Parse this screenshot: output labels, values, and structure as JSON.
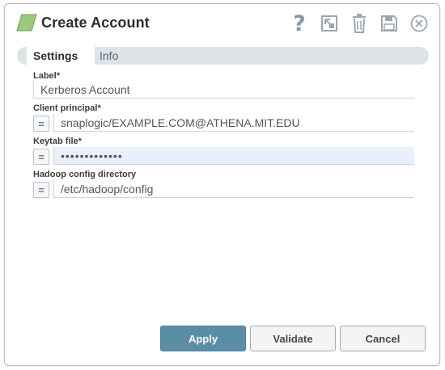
{
  "header": {
    "title": "Create Account",
    "help_label": "?",
    "icons": [
      "snap-logo-icon",
      "help-icon",
      "export-icon",
      "delete-icon",
      "save-icon",
      "close-icon"
    ]
  },
  "tabs": [
    {
      "label": "Settings",
      "active": true
    },
    {
      "label": "Info",
      "active": false
    }
  ],
  "fields": {
    "label": {
      "title": "Label*",
      "value": "Kerberos Account"
    },
    "client_principal": {
      "title": "Client principal*",
      "value": "snaplogic/EXAMPLE.COM@ATHENA.MIT.EDU",
      "expr_label": "="
    },
    "keytab_file": {
      "title": "Keytab file*",
      "value": "•••••••••••••",
      "expr_label": "="
    },
    "hadoop_config": {
      "title": "Hadoop config directory",
      "value": "/etc/hadoop/config",
      "expr_label": "="
    }
  },
  "footer": {
    "apply_label": "Apply",
    "validate_label": "Validate",
    "cancel_label": "Cancel"
  },
  "colors": {
    "accent": "#5b8ea6",
    "tab_bg": "#dde3e7",
    "icon": "#8a9aa6",
    "logo": "#8fbf6e"
  }
}
